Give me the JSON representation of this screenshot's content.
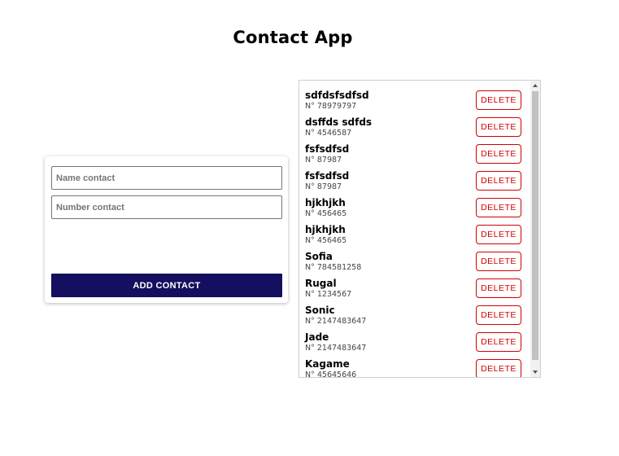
{
  "app": {
    "title": "Contact App"
  },
  "form": {
    "name_placeholder": "Name contact",
    "number_placeholder": "Number contact",
    "add_label": "ADD CONTACT"
  },
  "contacts": [
    {
      "name": "sdfdsfsdfsd",
      "number": "N° 78979797"
    },
    {
      "name": "dsffds sdfds",
      "number": "N° 4546587"
    },
    {
      "name": "fsfsdfsd",
      "number": "N° 87987"
    },
    {
      "name": "fsfsdfsd",
      "number": "N° 87987"
    },
    {
      "name": "hjkhjkh",
      "number": "N° 456465"
    },
    {
      "name": "hjkhjkh",
      "number": "N° 456465"
    },
    {
      "name": "Sofia",
      "number": "N° 784581258"
    },
    {
      "name": "Rugal",
      "number": "N° 1234567"
    },
    {
      "name": "Sonic",
      "number": "N° 2147483647"
    },
    {
      "name": "Jade",
      "number": "N° 2147483647"
    },
    {
      "name": "Kagame",
      "number": "N° 45645646"
    }
  ],
  "delete_label": "DELETE",
  "colors": {
    "accent": "#140f5f",
    "danger": "#d40000"
  },
  "icons": {
    "scroll_up": "triangle-up-icon",
    "scroll_down": "triangle-down-icon"
  }
}
